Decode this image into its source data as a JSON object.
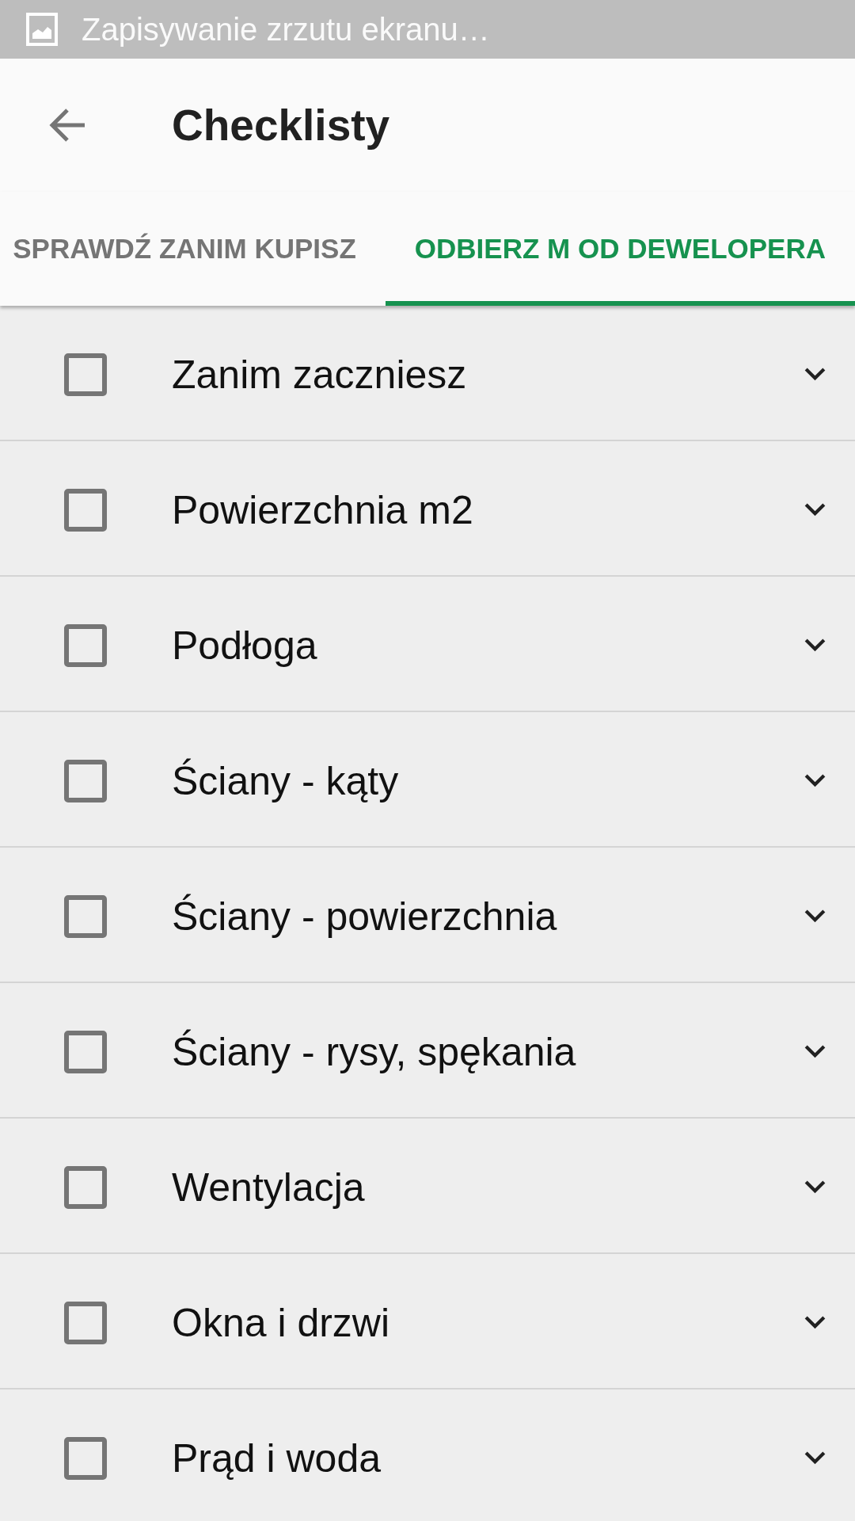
{
  "status_bar": {
    "notification_text": "Zapisywanie zrzutu ekranu…"
  },
  "app_bar": {
    "title": "Checklisty"
  },
  "tabs": [
    {
      "label": "SPRAWDŹ ZANIM KUPISZ",
      "selected": false
    },
    {
      "label": "ODBIERZ M OD DEWELOPERA",
      "selected": true
    }
  ],
  "checklist": [
    {
      "label": "Zanim zaczniesz",
      "checked": false,
      "expanded": false
    },
    {
      "label": "Powierzchnia m2",
      "checked": false,
      "expanded": false
    },
    {
      "label": "Podłoga",
      "checked": false,
      "expanded": false
    },
    {
      "label": "Ściany - kąty",
      "checked": false,
      "expanded": false
    },
    {
      "label": "Ściany - powierzchnia",
      "checked": false,
      "expanded": false
    },
    {
      "label": "Ściany - rysy, spękania",
      "checked": false,
      "expanded": false
    },
    {
      "label": "Wentylacja",
      "checked": false,
      "expanded": false
    },
    {
      "label": "Okna i drzwi",
      "checked": false,
      "expanded": false
    },
    {
      "label": "Prąd i woda",
      "checked": false,
      "expanded": false
    }
  ]
}
